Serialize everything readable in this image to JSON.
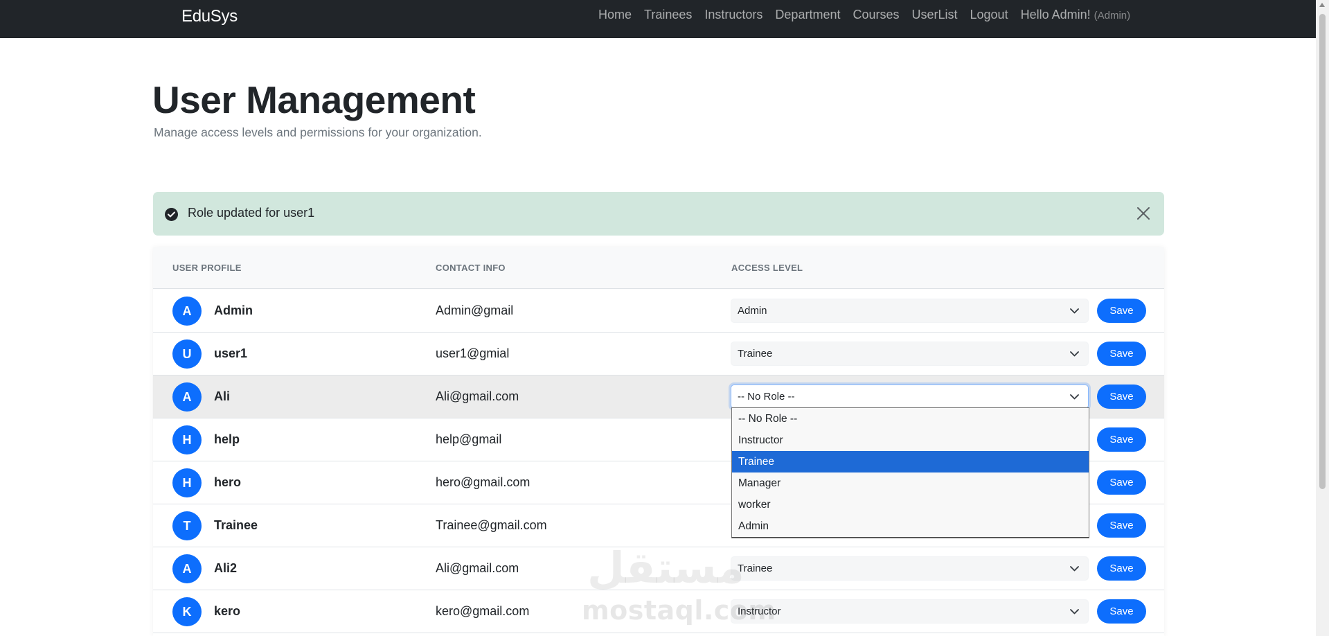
{
  "navbar": {
    "brand": "EduSys",
    "links": [
      {
        "label": "Home"
      },
      {
        "label": "Trainees"
      },
      {
        "label": "Instructors"
      },
      {
        "label": "Department"
      },
      {
        "label": "Courses"
      },
      {
        "label": "UserList"
      }
    ],
    "logout_label": "Logout",
    "greeting": "Hello Admin!",
    "role_tag": "(Admin)",
    "background": "#212529"
  },
  "header": {
    "title": "User Management",
    "subtitle": "Manage access levels and permissions for your organization."
  },
  "alert": {
    "message": "Role updated for user1",
    "icon": "check-circle-icon",
    "background": "#d1e7dd"
  },
  "table": {
    "columns": {
      "profile": "USER PROFILE",
      "contact": "CONTACT INFO",
      "access": "ACCESS LEVEL"
    },
    "save_label": "Save",
    "rows": [
      {
        "initial": "A",
        "name": "Admin",
        "email": "Admin@gmail",
        "role": "Admin"
      },
      {
        "initial": "U",
        "name": "user1",
        "email": "user1@gmial",
        "role": "Trainee"
      },
      {
        "initial": "A",
        "name": "Ali",
        "email": "Ali@gmail.com",
        "role": "-- No Role --"
      },
      {
        "initial": "H",
        "name": "help",
        "email": "help@gmail",
        "role": ""
      },
      {
        "initial": "H",
        "name": "hero",
        "email": "hero@gmail.com",
        "role": ""
      },
      {
        "initial": "T",
        "name": "Trainee",
        "email": "Trainee@gmail.com",
        "role": ""
      },
      {
        "initial": "A",
        "name": "Ali2",
        "email": "Ali@gmail.com",
        "role": "Trainee"
      },
      {
        "initial": "K",
        "name": "kero",
        "email": "kero@gmail.com",
        "role": "Instructor"
      }
    ]
  },
  "dropdown": {
    "options": [
      "-- No Role --",
      "Instructor",
      "Trainee",
      "Manager",
      "worker",
      "Admin"
    ],
    "highlighted": "Trainee"
  },
  "watermark": {
    "arabic": "مستقل",
    "latin": "mostaql.com"
  },
  "colors": {
    "accent": "#0d6efd",
    "highlight_option": "#1e6ad6",
    "muted_text": "#6c757d"
  }
}
